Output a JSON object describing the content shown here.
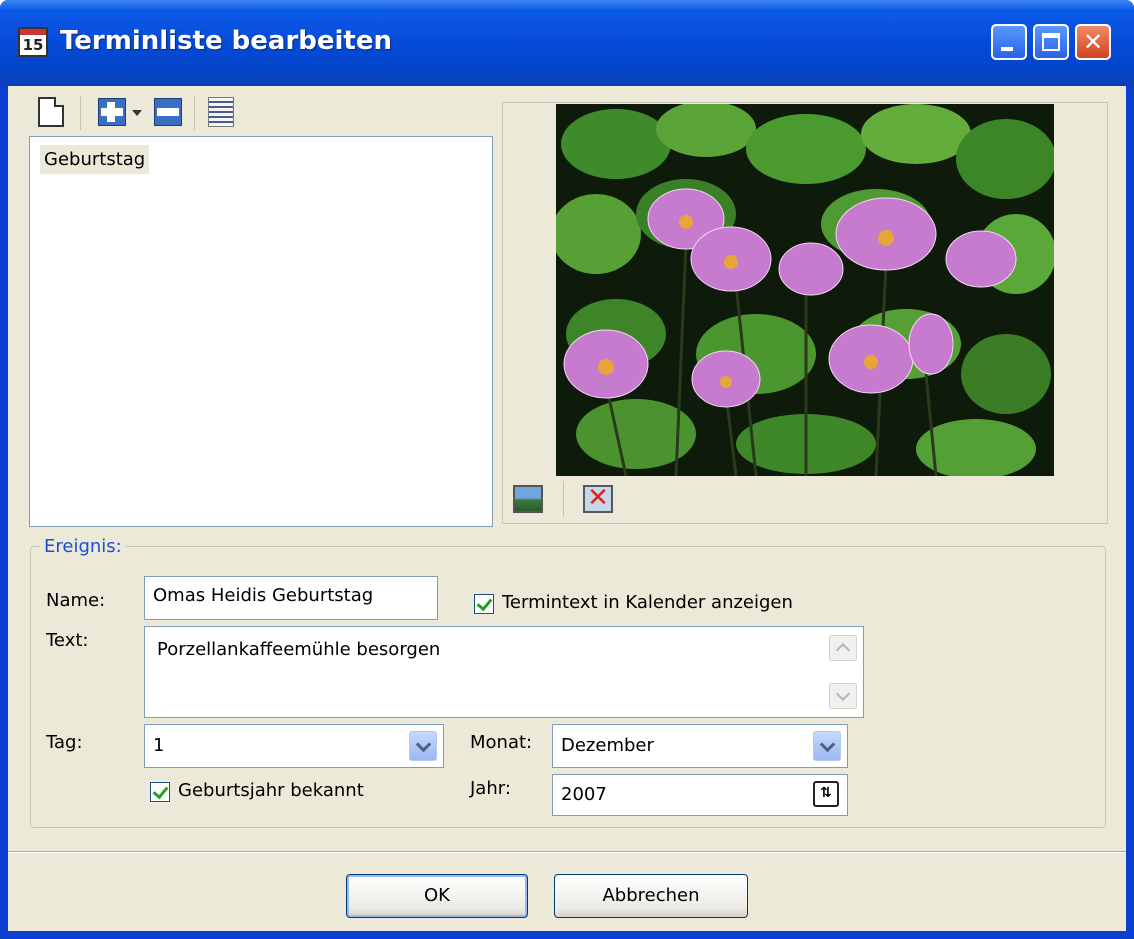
{
  "window": {
    "title": "Terminliste bearbeiten",
    "icon_text": "15",
    "close_glyph": "✕"
  },
  "toolbar": {
    "icons": [
      "new-document-icon",
      "add-icon",
      "dropdown-arrow-icon",
      "remove-icon",
      "list-icon"
    ]
  },
  "list": {
    "items": [
      {
        "label": "Geburtstag"
      }
    ]
  },
  "image_panel": {
    "icons": [
      "insert-image-icon",
      "delete-image-icon"
    ],
    "delete_glyph": "✕"
  },
  "event": {
    "legend": "Ereignis:",
    "name_label": "Name:",
    "name_value": "Omas Heidis Geburtstag",
    "show_in_calendar_label": "Termintext in Kalender anzeigen",
    "show_in_calendar_checked": true,
    "text_label": "Text:",
    "text_value": "Porzellankaffeemühle besorgen",
    "day_label": "Tag:",
    "day_value": "1",
    "month_label": "Monat:",
    "month_value": "Dezember",
    "birthyear_known_label": "Geburtsjahr bekannt",
    "birthyear_known_checked": true,
    "year_label": "Jahr:",
    "year_value": "2007",
    "spin_glyph": "⇅"
  },
  "buttons": {
    "ok": "OK",
    "cancel": "Abbrechen"
  },
  "colors": {
    "titlebar": "#0549d6",
    "dialog_bg": "#ece9d8",
    "legend": "#1c4fd1",
    "check": "#21a121"
  }
}
